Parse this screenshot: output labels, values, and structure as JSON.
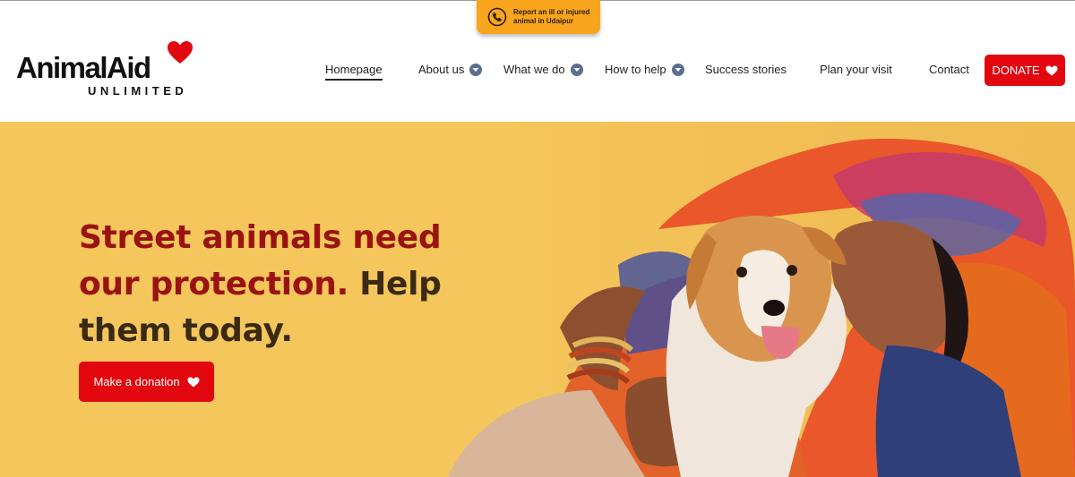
{
  "report": {
    "text": "Report an ill or injured animal in Udaipur"
  },
  "logo": {
    "main": "AnimalAid",
    "sub": "UNLIMITED"
  },
  "nav": {
    "items": [
      {
        "label": "Homepage"
      },
      {
        "label": "About us"
      },
      {
        "label": "What we do"
      },
      {
        "label": "How to help"
      },
      {
        "label": "Success stories"
      },
      {
        "label": "Plan your visit"
      },
      {
        "label": "Contact"
      }
    ],
    "donate": "DONATE"
  },
  "hero": {
    "headline_red": "Street animals need our protection.",
    "headline_rest": " Help them today.",
    "cta": "Make a donation"
  },
  "colors": {
    "brand_red": "#e2070f",
    "hero_bg": "#f4c65b",
    "headline_red": "#9b1212",
    "report_tab": "#f8a41c"
  }
}
